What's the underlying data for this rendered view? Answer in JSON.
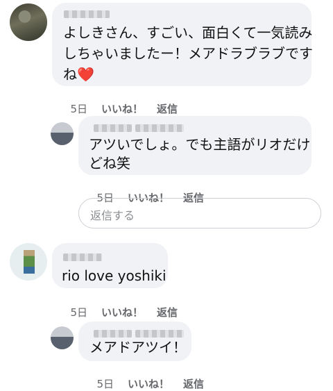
{
  "comments": [
    {
      "lines": [
        "よしきさん、すごい、面白くて一気読み",
        "しちゃいましたー！メアドラブラブです",
        "ね"
      ],
      "emoji": "❤️",
      "date": "5日",
      "like": "いいね！",
      "reply": "返信"
    },
    {
      "lines": [
        "アツいでしょ。でも主語がリオだけ",
        "どね笑"
      ],
      "date": "5日",
      "like": "いいね！",
      "reply": "返信"
    },
    {
      "lines": [
        "rio love yoshiki"
      ],
      "date": "5日",
      "like": "いいね！",
      "reply": "返信"
    },
    {
      "lines": [
        "メアドアツイ！"
      ],
      "date": "5日",
      "like": "いいね！",
      "reply": "返信"
    }
  ],
  "reply_input": {
    "placeholder": "返信する"
  }
}
